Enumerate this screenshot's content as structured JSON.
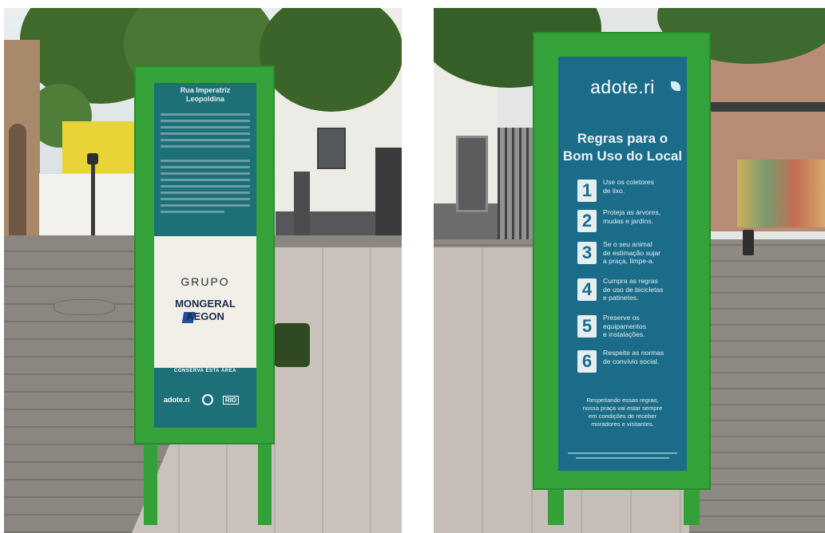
{
  "left_sign": {
    "title": "Rua Imperatriz\nLeopoldina",
    "group": "GRUPO",
    "brand_line1": "MONGERAL",
    "brand_line2": "AEGON",
    "conserve_label": "CONSERVA ESTA ÁREA",
    "footer_logo_adote": "adote.ri",
    "footer_logo_rio": "RIO"
  },
  "right_sign": {
    "logo": "adote.ri",
    "title": "Regras para o\nBom Uso do Local",
    "rules": [
      {
        "number": "1",
        "text": "Use os coletores\nde lixo."
      },
      {
        "number": "2",
        "text": "Proteja as árvores,\nmudas e jardins."
      },
      {
        "number": "3",
        "text": "Se o seu animal\nde estimação sujar\na praça, limpe-a."
      },
      {
        "number": "4",
        "text": "Cumpra as regras\nde uso de bicicletas\ne patinetes."
      },
      {
        "number": "5",
        "text": "Preserve os\nequipamentos\ne instalações."
      },
      {
        "number": "6",
        "text": "Respeite as normas\nde convívio social."
      }
    ],
    "footer": "Respeitando essas regras,\nnossa praça vai estar sempre\nem condições de receber\nmoradores e visitantes."
  },
  "colors": {
    "frame_green": "#35a23a",
    "panel_teal_left": "#1d6f78",
    "panel_blue_right": "#1a6c89"
  }
}
